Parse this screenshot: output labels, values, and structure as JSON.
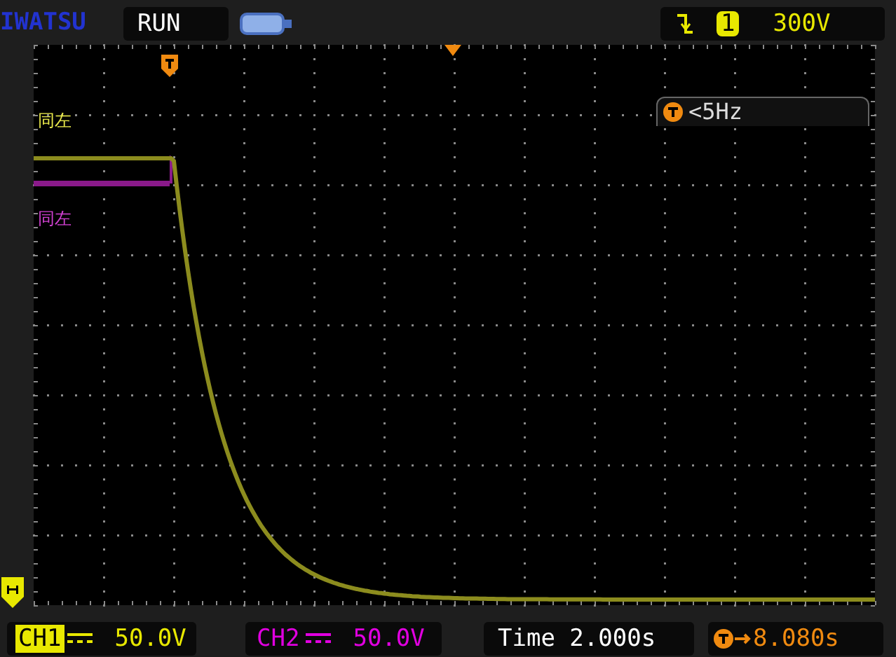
{
  "brand": "IWATSU",
  "run_state": "RUN",
  "trigger_info": {
    "channel": "1",
    "level": "300V"
  },
  "trigger_frequency": "<5Hz",
  "channel_labels": [
    {
      "text": "同左",
      "color": "#e8e84a"
    },
    {
      "text": "同左",
      "color": "#d040d0"
    }
  ],
  "channels": [
    {
      "name": "CH1",
      "scale": "50.0V",
      "color": "#e8e800",
      "selected": true
    },
    {
      "name": "CH2",
      "scale": "50.0V",
      "color": "#e000e0",
      "selected": false
    }
  ],
  "time_base": "Time 2.000s",
  "trigger_offset": "8.080s"
}
